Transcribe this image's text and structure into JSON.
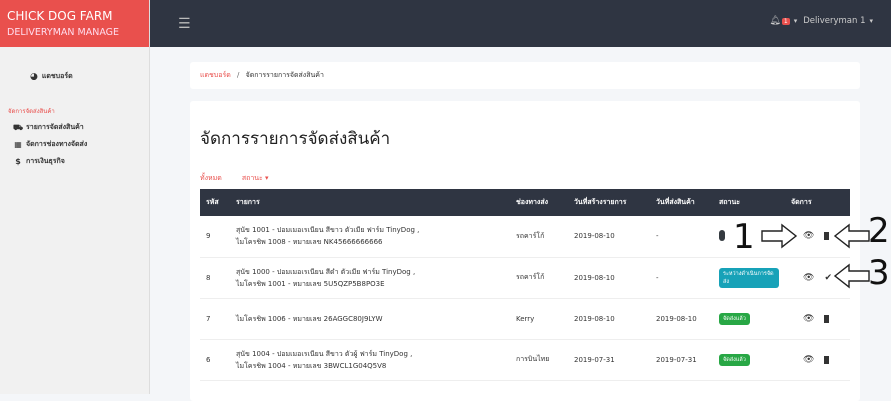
{
  "brand": {
    "line1": "CHICK DOG FARM",
    "line2": "DELIVERYMAN MANAGE"
  },
  "sidebar": {
    "dashboard": {
      "label": "แดชบอร์ด",
      "icon": "dashboard-icon"
    },
    "section": "จัดการจัดส่งสินค้า",
    "items": [
      {
        "label": "รายการจัดส่งสินค้า",
        "icon": "truck-icon"
      },
      {
        "label": "จัดการช่องทางจัดส่ง",
        "icon": "map-icon"
      },
      {
        "label": "การเงินธุรกิจ",
        "icon": "dollar-icon"
      }
    ]
  },
  "topbar": {
    "notif_count": "1",
    "user": "Deliveryman 1"
  },
  "breadcrumb": {
    "home": "แดชบอร์ด",
    "sep": "/",
    "current": "จัดการรายการจัดส่งสินค้า"
  },
  "page": {
    "title": "จัดการรายการจัดส่งสินค้า"
  },
  "filters": {
    "all": "ทั้งหมด",
    "status": "สถานะ ▾"
  },
  "table": {
    "headers": [
      "รหัส",
      "รายการ",
      "ช่องทางส่ง",
      "วันที่สร้างรายการ",
      "วันที่ส่งสินค้า",
      "สถานะ",
      "จัดการ"
    ],
    "rows": [
      {
        "id": "9",
        "item1": "สุนัข 1001 - ปอมเมอเรเนียน สีขาว ตัวเมีย ฟาร์ม TinyDog ,",
        "item2": "ไมโครชิพ 1008 - หมายเลข NK45666666666",
        "channel": "รถคาร์โก้",
        "created": "2019-08-10",
        "shipped": "-",
        "status": "",
        "status_type": "dark",
        "action2": "bin"
      },
      {
        "id": "8",
        "item1": "สุนัข 1000 - ปอมเมอเรเนียน สีดำ ตัวเมีย ฟาร์ม TinyDog ,",
        "item2": "ไมโครชิพ 1001 - หมายเลข 5U5QZP5B8PO3E",
        "channel": "รถคาร์โก้",
        "created": "2019-08-10",
        "shipped": "-",
        "status": "ระหว่างดำเนินการจัดส่ง",
        "status_type": "blue",
        "action2": "check"
      },
      {
        "id": "7",
        "item1": "ไมโครชิพ 1006 - หมายเลข 26AGGC80J9LYW",
        "item2": "",
        "channel": "Kerry",
        "created": "2019-08-10",
        "shipped": "2019-08-10",
        "status": "จัดส่งแล้ว",
        "status_type": "green",
        "action2": "bin"
      },
      {
        "id": "6",
        "item1": "สุนัข 1004 - ปอมเมอเรเนียน สีขาว ตัวผู้ ฟาร์ม TinyDog ,",
        "item2": "ไมโครชิพ 1004 - หมายเลข 3BWCL1G04Q5V8",
        "channel": "การบินไทย",
        "created": "2019-07-31",
        "shipped": "2019-07-31",
        "status": "จัดส่งแล้ว",
        "status_type": "green",
        "action2": "bin"
      }
    ]
  },
  "annotations": [
    "1",
    "2",
    "3"
  ]
}
